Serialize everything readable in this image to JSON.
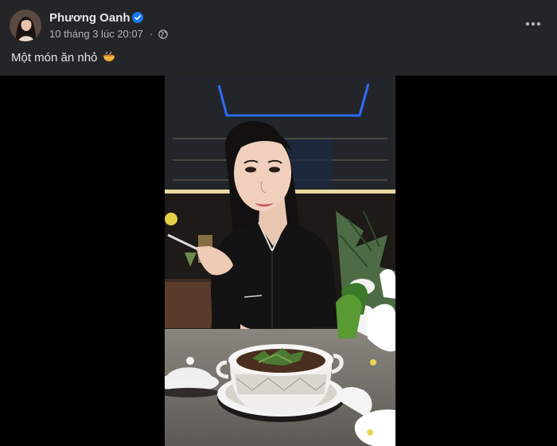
{
  "post": {
    "author": {
      "name": "Phương Oanh",
      "verified": true
    },
    "timestamp": "10 tháng 3 lúc 20:07",
    "separator": "·",
    "privacy_icon": "globe-icon",
    "more_icon": "more-options-icon",
    "caption": "Một món ăn nhỏ",
    "caption_emoji": "bowl-emoji"
  },
  "colors": {
    "background": "#242526",
    "text_primary": "#e4e6eb",
    "text_secondary": "#b0b3b8",
    "verified_blue": "#1877f2"
  }
}
